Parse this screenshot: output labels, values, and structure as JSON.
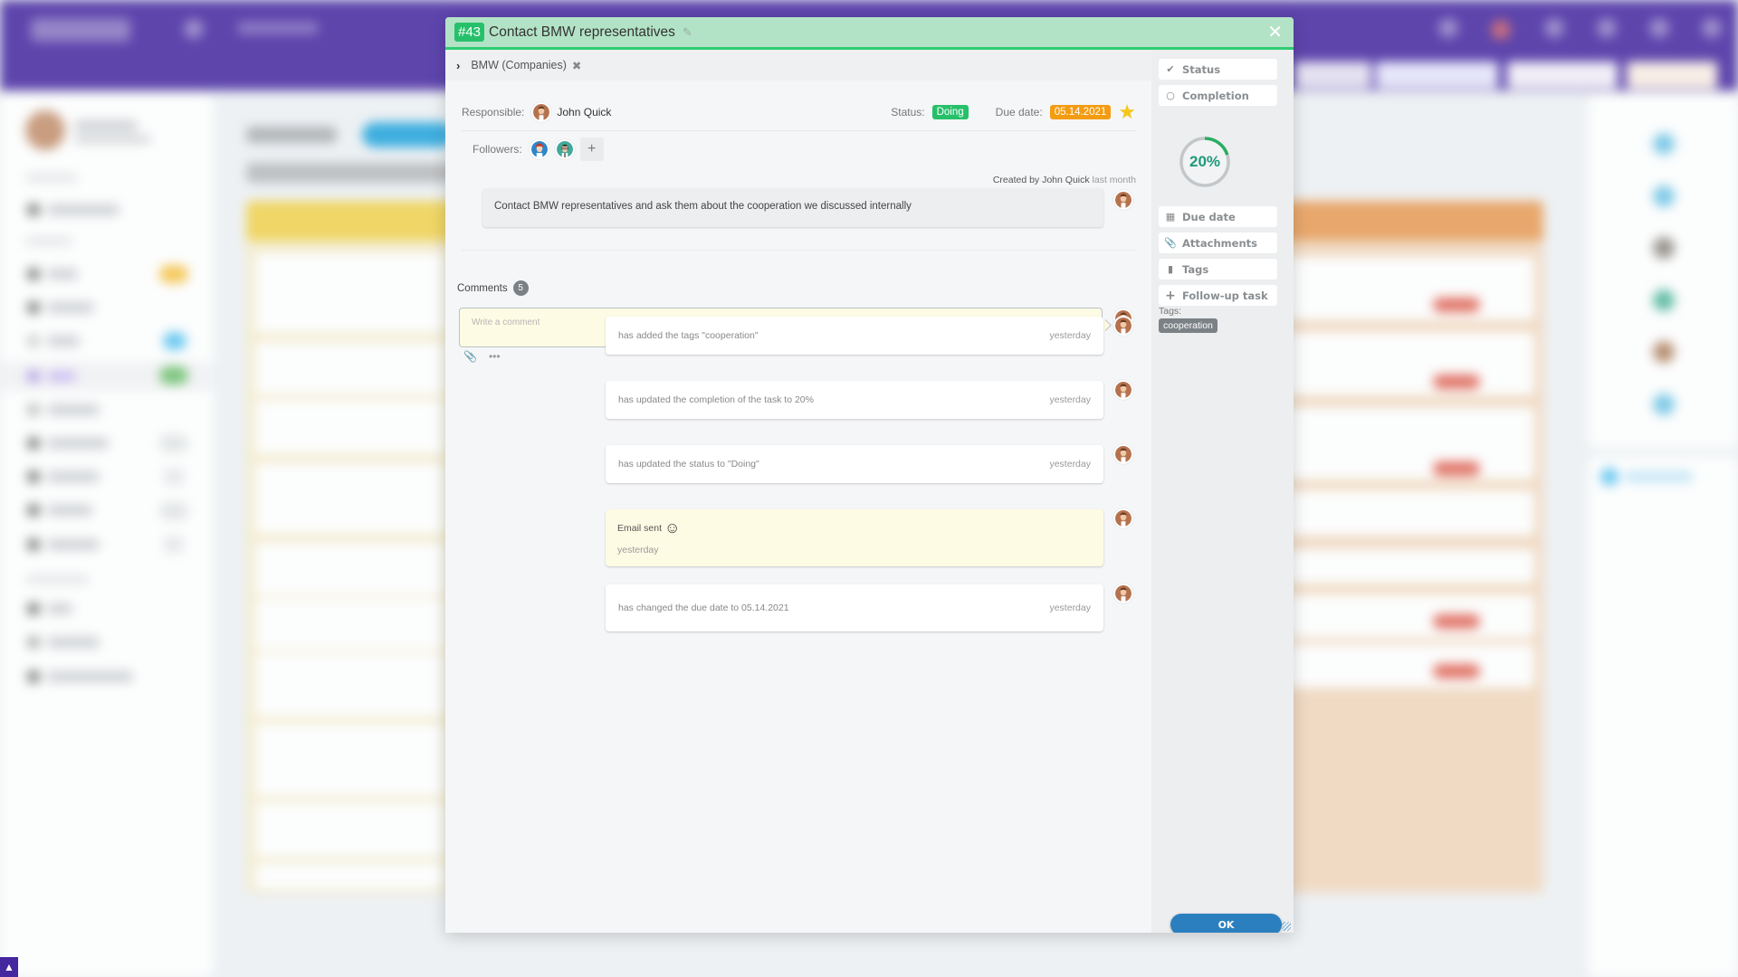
{
  "task": {
    "id": "#43",
    "title": "Contact BMW representatives",
    "breadcrumb": "BMW (Companies)",
    "responsible_label": "Responsible:",
    "responsible_name": "John Quick",
    "status_label": "Status:",
    "status_value": "Doing",
    "due_label": "Due date:",
    "due_value": "05.14.2021",
    "followers_label": "Followers:",
    "followers_add": "+",
    "created_by_prefix": "Created by John Quick",
    "created_by_when": "last month",
    "description": "Contact BMW representatives and ask them about the cooperation we discussed internally",
    "starred": true
  },
  "comments": {
    "label": "Comments",
    "count": "5",
    "input_placeholder": "Write a comment"
  },
  "activity": [
    {
      "text": "has added the tags \"cooperation\"",
      "time": "yesterday",
      "type": "log"
    },
    {
      "text": "has updated the completion of the task to 20%",
      "time": "yesterday",
      "type": "log"
    },
    {
      "text": "has updated the status to \"Doing\"",
      "time": "yesterday",
      "type": "log"
    },
    {
      "text": "Email sent",
      "time": "yesterday",
      "type": "email"
    },
    {
      "text": "has changed the due date to 05.14.2021",
      "time": "yesterday",
      "type": "log"
    }
  ],
  "sidebar": {
    "buttons": [
      {
        "label": "Status",
        "icon": "check-icon"
      },
      {
        "label": "Completion",
        "icon": "circle-icon"
      },
      {
        "label": "Due date",
        "icon": "calendar-icon"
      },
      {
        "label": "Attachments",
        "icon": "paperclip-icon"
      },
      {
        "label": "Tags",
        "icon": "bookmark-icon"
      },
      {
        "label": "Follow-up task",
        "icon": "plus-icon"
      }
    ],
    "completion_percent": 20,
    "completion_text": "20%",
    "tags_label": "Tags:",
    "tags": [
      "cooperation"
    ],
    "ok_label": "OK"
  },
  "colors": {
    "header_bg": "#b3e3c6",
    "header_line": "#2ecc71",
    "status_green": "#27c06a",
    "due_orange": "#f39c12",
    "progress_green": "#27ae60",
    "ok_blue": "#2b7fbf",
    "app_purple": "#4527a0"
  }
}
